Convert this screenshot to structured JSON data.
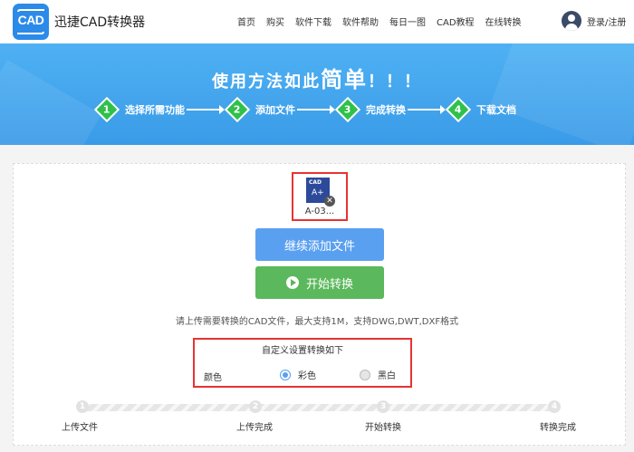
{
  "header": {
    "logo_text": "CAD",
    "brand": "迅捷CAD转换器",
    "nav": [
      "首页",
      "购买",
      "软件下载",
      "软件帮助",
      "每日一图",
      "CAD教程",
      "在线转换"
    ],
    "login": "登录/注册"
  },
  "banner": {
    "title_pre": "使用方法如此",
    "title_big": "简单",
    "title_post": "！！！",
    "steps": [
      {
        "num": "1",
        "label": "选择所需功能"
      },
      {
        "num": "2",
        "label": "添加文件"
      },
      {
        "num": "3",
        "label": "完成转换"
      },
      {
        "num": "4",
        "label": "下载文档"
      }
    ]
  },
  "file": {
    "icon_text": "CAD",
    "name": "A-03..."
  },
  "buttons": {
    "add": "继续添加文件",
    "start": "开始转换"
  },
  "hint": "请上传需要转换的CAD文件，最大支持1M，支持DWG,DWT,DXF格式",
  "settings": {
    "title": "自定义设置转换如下",
    "color_label": "颜色",
    "options": [
      {
        "label": "彩色",
        "selected": true
      },
      {
        "label": "黑白",
        "selected": false
      }
    ]
  },
  "progress": {
    "current_step": 1,
    "steps": [
      {
        "num": "1",
        "label": "上传文件"
      },
      {
        "num": "2",
        "label": "上传完成"
      },
      {
        "num": "3",
        "label": "开始转换"
      },
      {
        "num": "4",
        "label": "转换完成"
      }
    ]
  },
  "colors": {
    "primary": "#5aa0f0",
    "success": "#5cb85c",
    "highlight": "#e63333",
    "banner": "#3a9be8",
    "step_green": "#2fc14a"
  }
}
